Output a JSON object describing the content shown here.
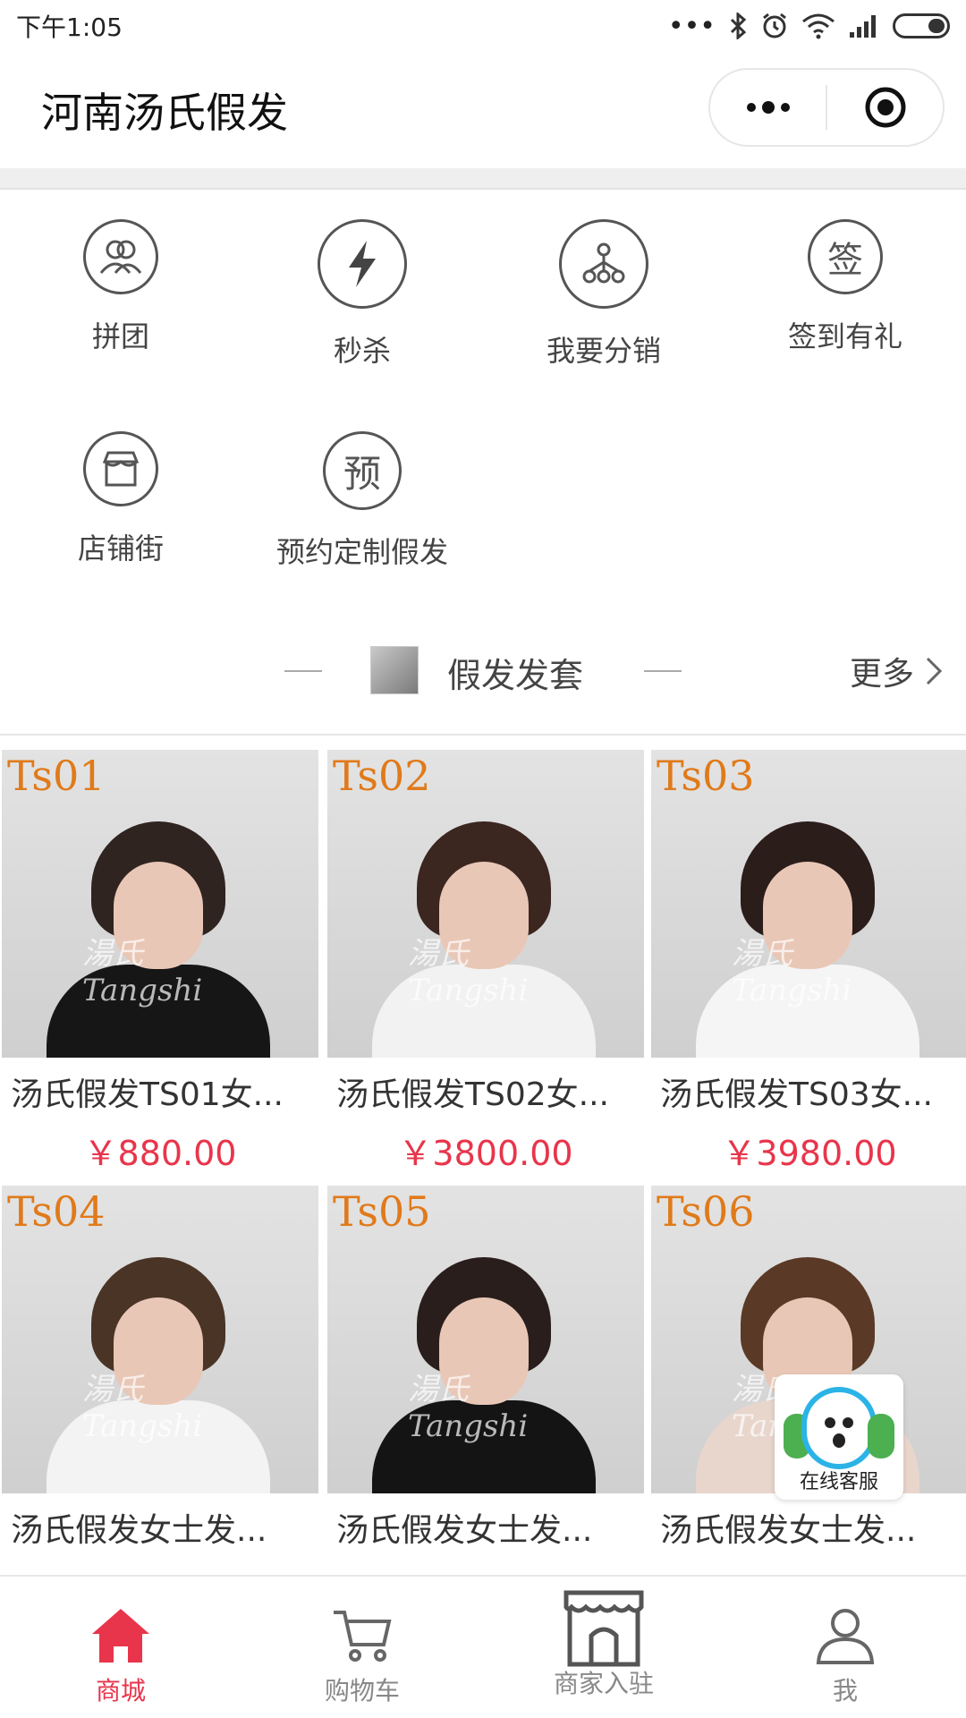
{
  "status_bar": {
    "time": "下午1:05",
    "signal_dots": "•••"
  },
  "nav": {
    "title": "河南汤氏假发"
  },
  "quick_menu": [
    {
      "label": "拼团",
      "icon": "group-icon"
    },
    {
      "label": "秒杀",
      "icon": "lightning-icon"
    },
    {
      "label": "我要分销",
      "icon": "share-tree-icon"
    },
    {
      "label": "签到有礼",
      "icon": "sign-in-icon",
      "glyph": "签"
    },
    {
      "label": "店铺街",
      "icon": "shop-street-icon"
    },
    {
      "label": "预约定制假发",
      "icon": "reserve-icon",
      "glyph": "预"
    }
  ],
  "section": {
    "title": "假发发套",
    "more": "更多"
  },
  "products": [
    {
      "code": "Ts01",
      "name": "汤氏假发TS01女...",
      "price": "￥880.00",
      "hair": "#2f2420",
      "dress": "#161616"
    },
    {
      "code": "Ts02",
      "name": "汤氏假发TS02女...",
      "price": "￥3800.00",
      "hair": "#3b2620",
      "dress": "#f2f2f2"
    },
    {
      "code": "Ts03",
      "name": "汤氏假发TS03女...",
      "price": "￥3980.00",
      "hair": "#2a1d1a",
      "dress": "#f5f5f5"
    },
    {
      "code": "Ts04",
      "name": "汤氏假发女士发...",
      "price": "",
      "hair": "#4a3426",
      "dress": "#f3f3f3"
    },
    {
      "code": "Ts05",
      "name": "汤氏假发女士发...",
      "price": "",
      "hair": "#2a1e1c",
      "dress": "#141414"
    },
    {
      "code": "Ts06",
      "name": "汤氏假发女士发...",
      "price": "",
      "hair": "#5a3a26",
      "dress": "#e8d6cc"
    }
  ],
  "watermark": {
    "cn": "湯氏",
    "en": "Tangshi"
  },
  "customer_service": {
    "label": "在线客服"
  },
  "tabbar": [
    {
      "label": "商城",
      "icon": "home-icon",
      "active": true
    },
    {
      "label": "购物车",
      "icon": "cart-icon",
      "active": false
    },
    {
      "label": "商家入驻",
      "icon": "storefront-icon",
      "active": false
    },
    {
      "label": "我",
      "icon": "user-icon",
      "active": false
    }
  ],
  "colors": {
    "accent": "#e8354b",
    "code_orange": "#e07a1a"
  }
}
